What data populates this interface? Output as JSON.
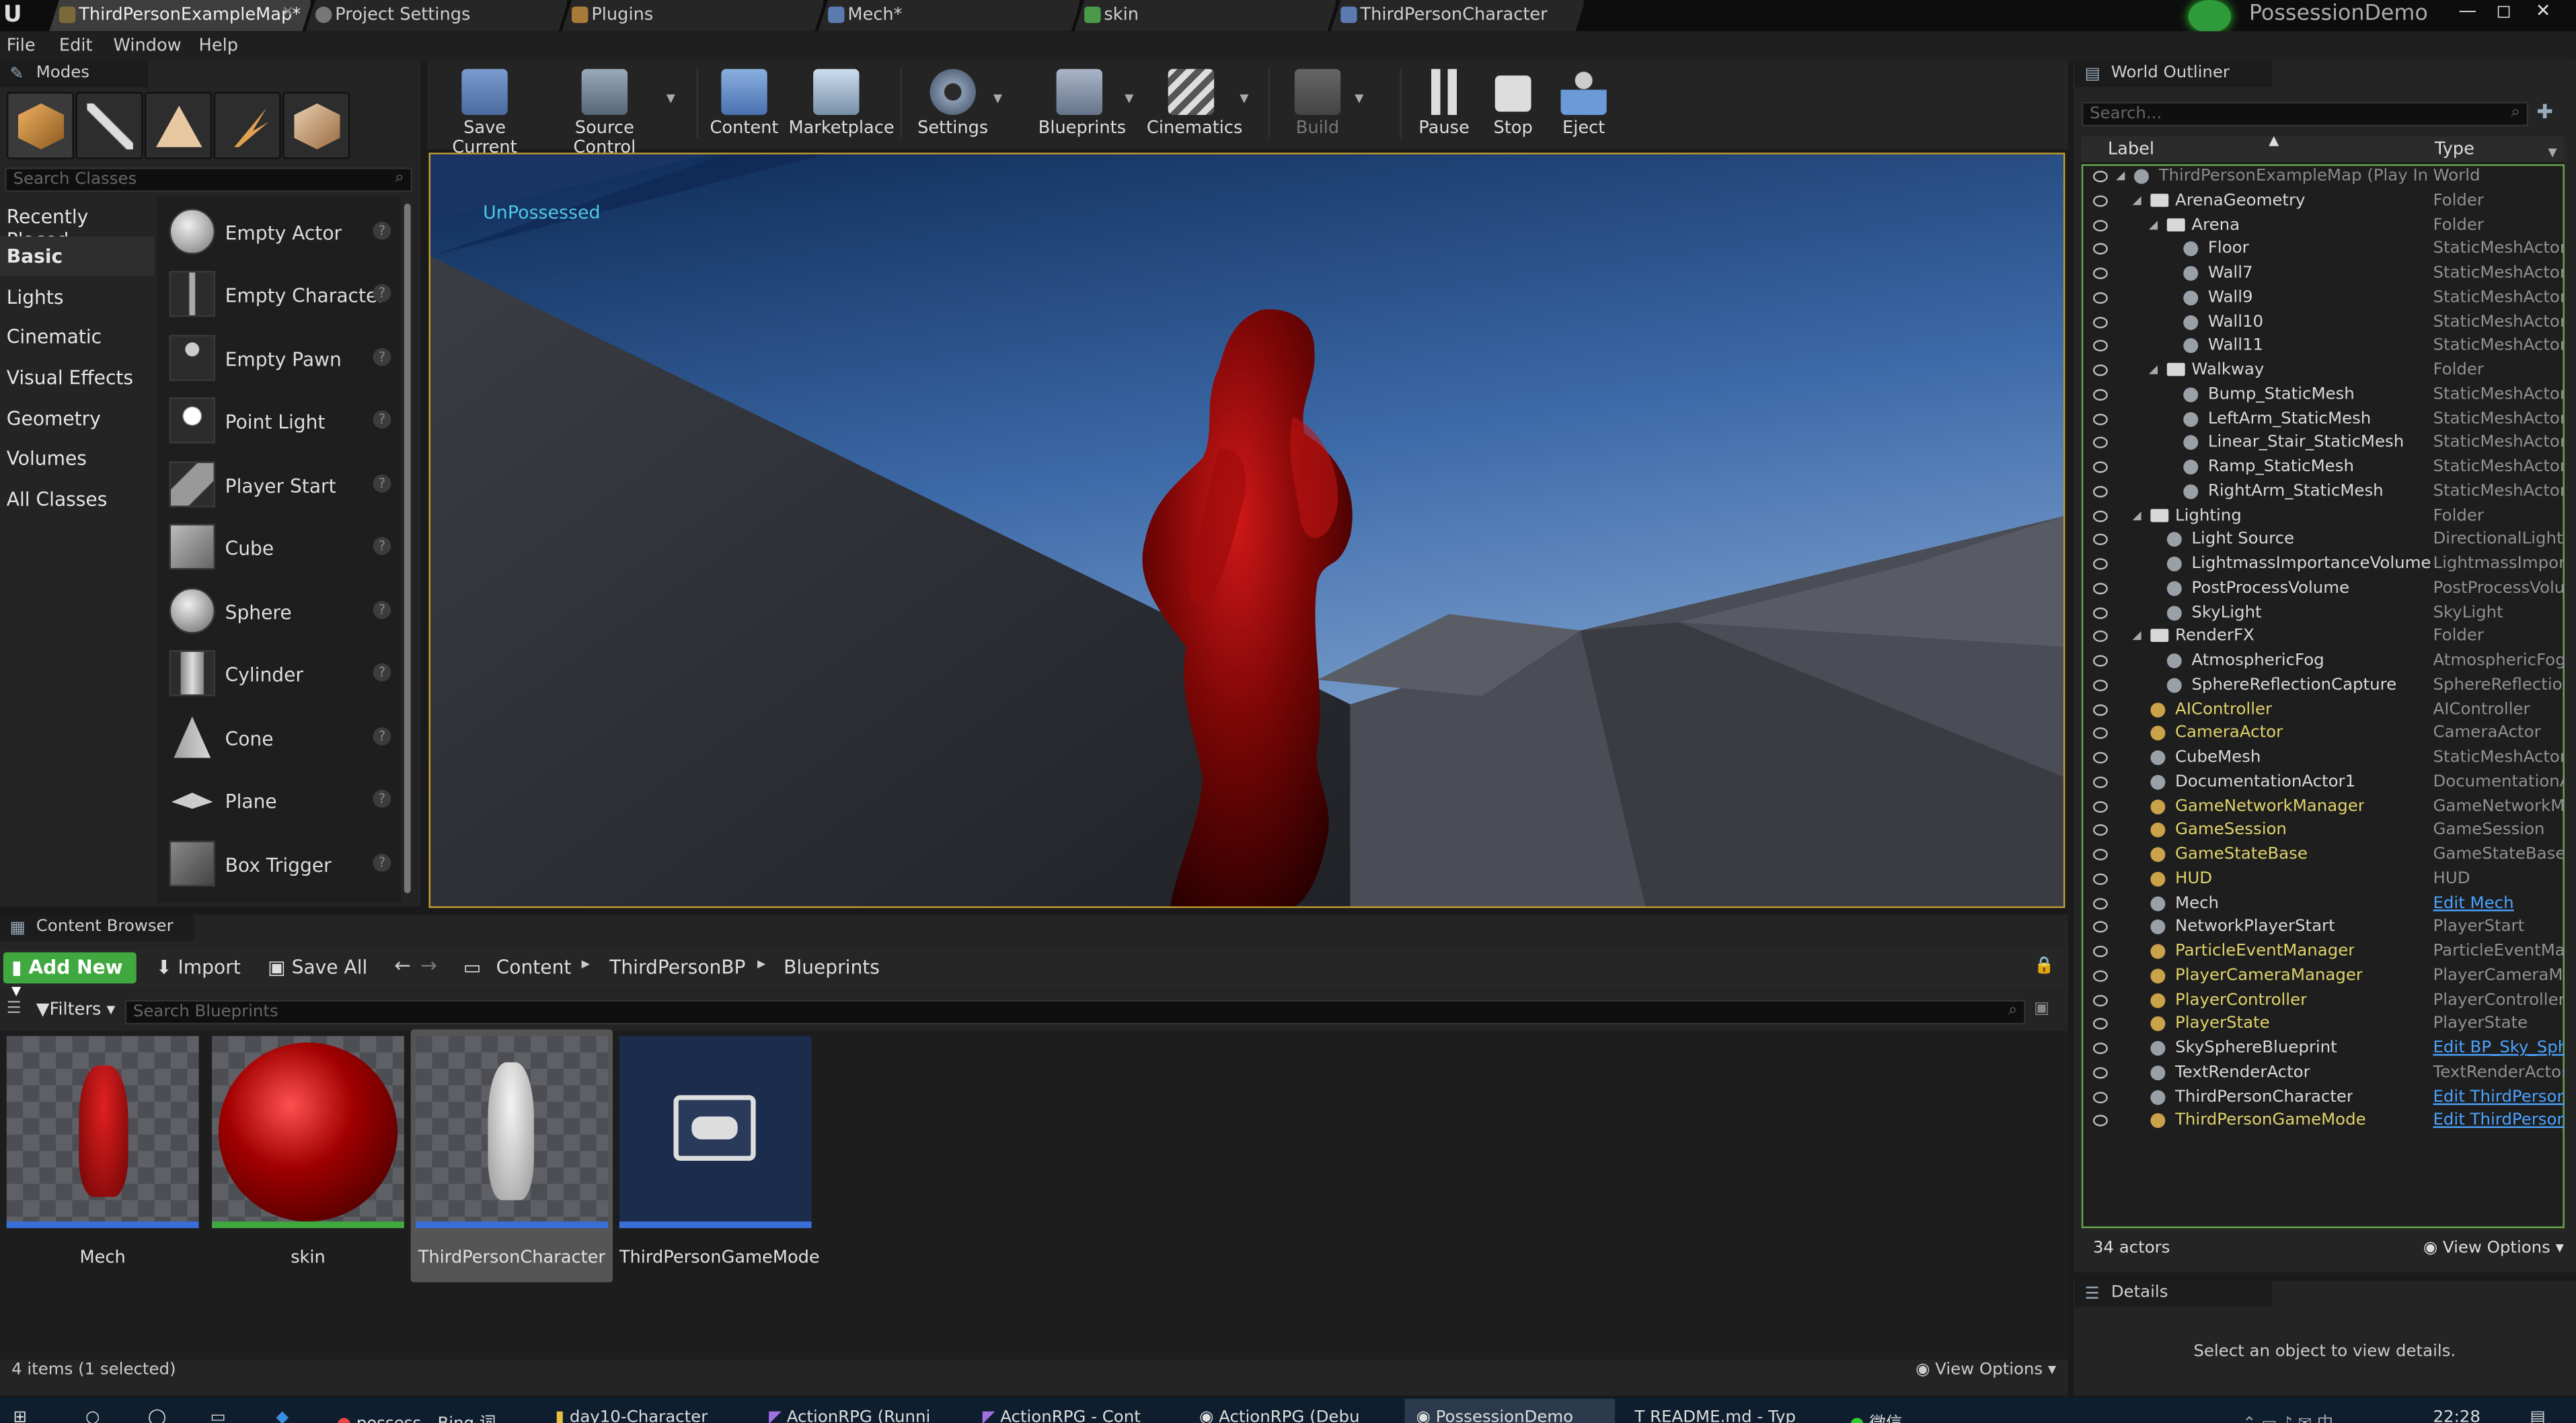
{
  "tabs": [
    {
      "label": "ThirdPersonExampleMap*",
      "active": true
    },
    {
      "label": "Project Settings"
    },
    {
      "label": "Plugins"
    },
    {
      "label": "Mech*"
    },
    {
      "label": "skin"
    },
    {
      "label": "ThirdPersonCharacter"
    }
  ],
  "project_name": "PossessionDemo",
  "menu": [
    "File",
    "Edit",
    "Window",
    "Help"
  ],
  "modes": {
    "title": "Modes",
    "search_placeholder": "Search Classes",
    "categories": [
      "Recently Placed",
      "Basic",
      "Lights",
      "Cinematic",
      "Visual Effects",
      "Geometry",
      "Volumes",
      "All Classes"
    ],
    "selected_category": "Basic",
    "items": [
      "Empty Actor",
      "Empty Character",
      "Empty Pawn",
      "Point Light",
      "Player Start",
      "Cube",
      "Sphere",
      "Cylinder",
      "Cone",
      "Plane",
      "Box Trigger"
    ]
  },
  "toolbar": {
    "save_current": "Save Current",
    "source_control": "Source Control",
    "content": "Content",
    "marketplace": "Marketplace",
    "settings": "Settings",
    "blueprints": "Blueprints",
    "cinematics": "Cinematics",
    "build": "Build",
    "pause": "Pause",
    "stop": "Stop",
    "eject": "Eject"
  },
  "viewport": {
    "overlay_text": "UnPossessed"
  },
  "outliner": {
    "title": "World Outliner",
    "search_placeholder": "Search...",
    "col_label": "Label",
    "col_type": "Type",
    "rows": [
      {
        "label": "ThirdPersonExampleMap (Play In Editor)",
        "type": "World",
        "indent": 0,
        "style": "gry"
      },
      {
        "label": "ArenaGeometry",
        "type": "Folder",
        "indent": 1,
        "style": "wht"
      },
      {
        "label": "Arena",
        "type": "Folder",
        "indent": 2,
        "style": "wht"
      },
      {
        "label": "Floor",
        "type": "StaticMeshActor",
        "indent": 3,
        "style": "wht"
      },
      {
        "label": "Wall7",
        "type": "StaticMeshActor",
        "indent": 3,
        "style": "wht"
      },
      {
        "label": "Wall9",
        "type": "StaticMeshActor",
        "indent": 3,
        "style": "wht"
      },
      {
        "label": "Wall10",
        "type": "StaticMeshActor",
        "indent": 3,
        "style": "wht"
      },
      {
        "label": "Wall11",
        "type": "StaticMeshActor",
        "indent": 3,
        "style": "wht"
      },
      {
        "label": "Walkway",
        "type": "Folder",
        "indent": 2,
        "style": "wht"
      },
      {
        "label": "Bump_StaticMesh",
        "type": "StaticMeshActor",
        "indent": 3,
        "style": "wht"
      },
      {
        "label": "LeftArm_StaticMesh",
        "type": "StaticMeshActor",
        "indent": 3,
        "style": "wht"
      },
      {
        "label": "Linear_Stair_StaticMesh",
        "type": "StaticMeshActor",
        "indent": 3,
        "style": "wht"
      },
      {
        "label": "Ramp_StaticMesh",
        "type": "StaticMeshActor",
        "indent": 3,
        "style": "wht"
      },
      {
        "label": "RightArm_StaticMesh",
        "type": "StaticMeshActor",
        "indent": 3,
        "style": "wht"
      },
      {
        "label": "Lighting",
        "type": "Folder",
        "indent": 1,
        "style": "wht"
      },
      {
        "label": "Light Source",
        "type": "DirectionalLight",
        "indent": 2,
        "style": "wht"
      },
      {
        "label": "LightmassImportanceVolume",
        "type": "LightmassImportanceVolume",
        "indent": 2,
        "style": "wht"
      },
      {
        "label": "PostProcessVolume",
        "type": "PostProcessVolume",
        "indent": 2,
        "style": "wht"
      },
      {
        "label": "SkyLight",
        "type": "SkyLight",
        "indent": 2,
        "style": "wht"
      },
      {
        "label": "RenderFX",
        "type": "Folder",
        "indent": 1,
        "style": "wht"
      },
      {
        "label": "AtmosphericFog",
        "type": "AtmosphericFog",
        "indent": 2,
        "style": "wht"
      },
      {
        "label": "SphereReflectionCapture",
        "type": "SphereReflectionCapture",
        "indent": 2,
        "style": "wht"
      },
      {
        "label": "AIController",
        "type": "AIController",
        "indent": 1,
        "style": "yel"
      },
      {
        "label": "CameraActor",
        "type": "CameraActor",
        "indent": 1,
        "style": "yel"
      },
      {
        "label": "CubeMesh",
        "type": "StaticMeshActor",
        "indent": 1,
        "style": "wht"
      },
      {
        "label": "DocumentationActor1",
        "type": "DocumentationActor",
        "indent": 1,
        "style": "wht"
      },
      {
        "label": "GameNetworkManager",
        "type": "GameNetworkManager",
        "indent": 1,
        "style": "yel"
      },
      {
        "label": "GameSession",
        "type": "GameSession",
        "indent": 1,
        "style": "yel"
      },
      {
        "label": "GameStateBase",
        "type": "GameStateBase",
        "indent": 1,
        "style": "yel"
      },
      {
        "label": "HUD",
        "type": "HUD",
        "indent": 1,
        "style": "yel"
      },
      {
        "label": "Mech",
        "type": "Edit Mech",
        "indent": 1,
        "style": "wht",
        "link": true
      },
      {
        "label": "NetworkPlayerStart",
        "type": "PlayerStart",
        "indent": 1,
        "style": "wht"
      },
      {
        "label": "ParticleEventManager",
        "type": "ParticleEventManager",
        "indent": 1,
        "style": "yel"
      },
      {
        "label": "PlayerCameraManager",
        "type": "PlayerCameraManager",
        "indent": 1,
        "style": "yel"
      },
      {
        "label": "PlayerController",
        "type": "PlayerController",
        "indent": 1,
        "style": "yel"
      },
      {
        "label": "PlayerState",
        "type": "PlayerState",
        "indent": 1,
        "style": "yel"
      },
      {
        "label": "SkySphereBlueprint",
        "type": "Edit BP_Sky_Sphere",
        "indent": 1,
        "style": "wht",
        "link": true
      },
      {
        "label": "TextRenderActor",
        "type": "TextRenderActor",
        "indent": 1,
        "style": "wht"
      },
      {
        "label": "ThirdPersonCharacter",
        "type": "Edit ThirdPersonCharacter",
        "indent": 1,
        "style": "wht",
        "link": true
      },
      {
        "label": "ThirdPersonGameMode",
        "type": "Edit ThirdPersonGameMode",
        "indent": 1,
        "style": "yel",
        "link": true
      }
    ],
    "actor_count": "34 actors",
    "view_options": "View Options"
  },
  "details": {
    "title": "Details",
    "empty_text": "Select an object to view details."
  },
  "content_browser": {
    "title": "Content Browser",
    "add_new": "Add New",
    "import": "Import",
    "save_all": "Save All",
    "breadcrumb": [
      "Content",
      "ThirdPersonBP",
      "Blueprints"
    ],
    "filters": "Filters",
    "search_placeholder": "Search Blueprints",
    "assets": [
      {
        "name": "Mech",
        "bar": "#3a6fd8"
      },
      {
        "name": "skin",
        "bar": "#3fa83f"
      },
      {
        "name": "ThirdPersonCharacter",
        "bar": "#3a6fd8",
        "selected": true
      },
      {
        "name": "ThirdPersonGameMode",
        "bar": "#3a6fd8"
      }
    ],
    "status": "4 items (1 selected)",
    "view_options": "View Options"
  },
  "taskbar": {
    "items": [
      "possess - Bing 词",
      "day10-Character",
      "ActionRPG (Runni",
      "ActionRPG - Cont",
      "ActionRPG (Debu",
      "PossessionDemo",
      "README.md - Typ",
      "微信"
    ],
    "clock": "22:28"
  },
  "colors": {
    "accent_yellow": "#d8b23a",
    "link_blue": "#4aa3ff",
    "add_new_green": "#3fa83f",
    "outliner_border": "#6aa84f"
  }
}
